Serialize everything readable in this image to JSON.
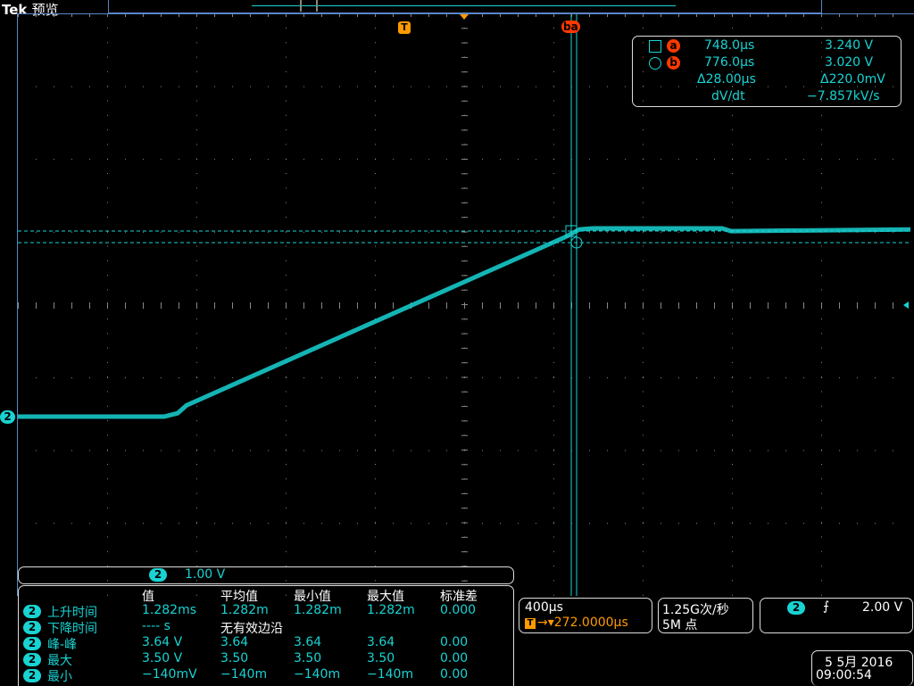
{
  "header": {
    "brand": "Tek",
    "mode": "预览"
  },
  "colors": {
    "trace": "#19d3d3",
    "cursor_label": "#ff3a00",
    "trigger": "#ff9a00",
    "grid": "#888888"
  },
  "cursor_readout": {
    "a": {
      "label": "a",
      "time": "748.0µs",
      "voltage": "3.240 V"
    },
    "b": {
      "label": "b",
      "time": "776.0µs",
      "voltage": "3.020 V"
    },
    "delta_time": "Δ28.00µs",
    "delta_voltage": "Δ220.0mV",
    "rate_label": "dV/dt",
    "rate_value": "−7.857kV/s"
  },
  "markers": {
    "trigger": "T",
    "cursors": "ba",
    "channel": "2"
  },
  "channel": {
    "number": "2",
    "scale": "1.00 V"
  },
  "measurements": {
    "headers": [
      "值",
      "平均值",
      "最小值",
      "最大值",
      "标准差"
    ],
    "rows": [
      {
        "ch": "2",
        "name": "上升时间",
        "value": "1.282ms",
        "mean": "1.282m",
        "min": "1.282m",
        "max": "1.282m",
        "std": "0.000"
      },
      {
        "ch": "2",
        "name": "下降时间",
        "value": "---- s",
        "note": "无有效边沿"
      },
      {
        "ch": "2",
        "name": "峰-峰",
        "value": "3.64 V",
        "mean": "3.64",
        "min": "3.64",
        "max": "3.64",
        "std": "0.00"
      },
      {
        "ch": "2",
        "name": "最大",
        "value": "3.50 V",
        "mean": "3.50",
        "min": "3.50",
        "max": "3.50",
        "std": "0.00"
      },
      {
        "ch": "2",
        "name": "最小",
        "value": "−140mV",
        "mean": "−140m",
        "min": "−140m",
        "max": "−140m",
        "std": "0.00"
      }
    ]
  },
  "horizontal": {
    "scale": "400µs",
    "trigger_icon": "T",
    "position": "→▾272.0000µs"
  },
  "acquisition": {
    "rate": "1.25G次/秒",
    "record": "5M 点"
  },
  "trigger": {
    "channel": "2",
    "slope": "rising",
    "level": "2.00 V"
  },
  "datetime": {
    "date": "5 5月  2016",
    "time": "09:00:54"
  },
  "waveform": {
    "time_us": [
      -1756,
      -1100,
      -1040,
      -1000,
      700,
      760,
      820,
      1400,
      1440,
      2244
    ],
    "volts": [
      0,
      0,
      0.06,
      0.2,
      3.2,
      3.33,
      3.35,
      3.35,
      3.3,
      3.33
    ]
  }
}
